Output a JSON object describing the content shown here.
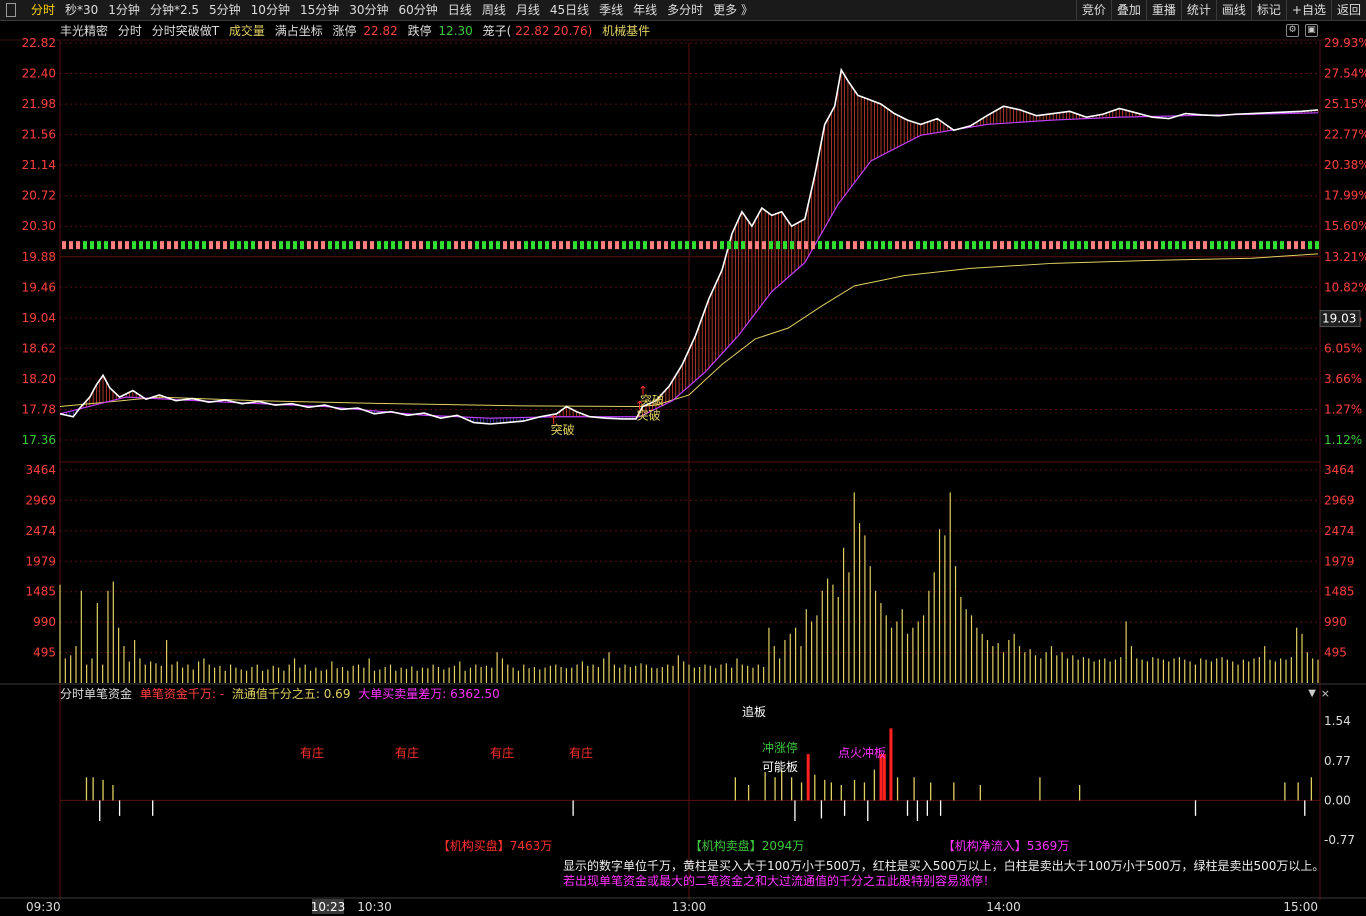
{
  "toolbar": {
    "periods": [
      "分时",
      "秒*30",
      "1分钟",
      "分钟*2.5",
      "5分钟",
      "10分钟",
      "15分钟",
      "30分钟",
      "60分钟",
      "日线",
      "周线",
      "月线",
      "45日线",
      "季线",
      "年线",
      "多分时",
      "更多 》"
    ],
    "active_period": "分时",
    "right_tools": [
      "竞价",
      "叠加",
      "重播",
      "统计",
      "画线",
      "标记",
      "+自选",
      "返回"
    ]
  },
  "info": {
    "stock_name": "丰光精密",
    "view": "分时",
    "indicator": "分时突破做T",
    "volume_label": "成交量",
    "coord_label": "满占坐标",
    "limit_up_label": "涨停",
    "limit_up": "22.82",
    "limit_down_label": "跌停",
    "limit_down": "12.30",
    "cage_label": "笼子(",
    "cage_values": "22.82 20.76)",
    "sector": "机械基件"
  },
  "colors": {
    "up": "#ff4040",
    "down": "#3cc83c",
    "price_line": "#ffffff",
    "avg_line": "#c040ff",
    "yellow_line": "#e0d060",
    "grid": "#5a1010",
    "volume": "#e0d060",
    "axis_text_up": "#ff4040",
    "axis_text_down": "#3cc83c"
  },
  "current_price_tag": "19.03",
  "time_cursor": "10:23",
  "chart_data": [
    {
      "type": "line",
      "title": "分时",
      "y_left_ticks": [
        "22.82",
        "22.40",
        "21.98",
        "21.56",
        "21.14",
        "20.72",
        "20.30",
        "19.88",
        "19.46",
        "19.04",
        "18.62",
        "18.20",
        "17.78",
        "17.36"
      ],
      "y_right_ticks": [
        "29.93%",
        "27.54%",
        "25.15%",
        "22.77%",
        "20.38%",
        "17.99%",
        "15.60%",
        "13.21%",
        "10.82%",
        "8.44%",
        "6.05%",
        "3.66%",
        "1.27%",
        "1.12%"
      ],
      "ylim": [
        17.36,
        22.82
      ],
      "x_ticks": [
        "09:30",
        "10:30",
        "13:00",
        "14:00",
        "15:00"
      ],
      "series": [
        {
          "name": "分时",
          "points": [
            [
              0,
              17.72
            ],
            [
              4,
              17.68
            ],
            [
              6,
              17.8
            ],
            [
              9,
              17.95
            ],
            [
              11,
              18.12
            ],
            [
              13,
              18.25
            ],
            [
              15,
              18.08
            ],
            [
              18,
              17.95
            ],
            [
              22,
              18.04
            ],
            [
              26,
              17.92
            ],
            [
              30,
              17.98
            ],
            [
              35,
              17.9
            ],
            [
              40,
              17.93
            ],
            [
              45,
              17.88
            ],
            [
              50,
              17.91
            ],
            [
              55,
              17.86
            ],
            [
              60,
              17.89
            ],
            [
              65,
              17.84
            ],
            [
              70,
              17.86
            ],
            [
              75,
              17.81
            ],
            [
              80,
              17.84
            ],
            [
              85,
              17.78
            ],
            [
              90,
              17.8
            ],
            [
              95,
              17.72
            ],
            [
              100,
              17.75
            ],
            [
              105,
              17.7
            ],
            [
              110,
              17.73
            ],
            [
              115,
              17.66
            ],
            [
              120,
              17.7
            ],
            [
              125,
              17.6
            ],
            [
              130,
              17.58
            ],
            [
              135,
              17.6
            ],
            [
              140,
              17.62
            ],
            [
              145,
              17.68
            ],
            [
              150,
              17.72
            ],
            [
              153,
              17.82
            ],
            [
              156,
              17.75
            ],
            [
              160,
              17.68
            ],
            [
              165,
              17.66
            ],
            [
              170,
              17.65
            ],
            [
              174,
              17.65
            ],
            [
              176,
              17.82
            ],
            [
              180,
              17.9
            ],
            [
              184,
              18.1
            ],
            [
              188,
              18.4
            ],
            [
              192,
              18.8
            ],
            [
              196,
              19.3
            ],
            [
              200,
              19.7
            ],
            [
              203,
              20.2
            ],
            [
              206,
              20.5
            ],
            [
              209,
              20.3
            ],
            [
              212,
              20.55
            ],
            [
              215,
              20.45
            ],
            [
              218,
              20.5
            ],
            [
              221,
              20.3
            ],
            [
              225,
              20.4
            ],
            [
              228,
              21.0
            ],
            [
              231,
              21.7
            ],
            [
              234,
              21.95
            ],
            [
              236,
              22.45
            ],
            [
              238,
              22.3
            ],
            [
              241,
              22.1
            ],
            [
              244,
              22.05
            ],
            [
              248,
              21.98
            ],
            [
              252,
              21.85
            ],
            [
              256,
              21.76
            ],
            [
              260,
              21.7
            ],
            [
              265,
              21.78
            ],
            [
              270,
              21.62
            ],
            [
              275,
              21.68
            ],
            [
              280,
              21.82
            ],
            [
              285,
              21.95
            ],
            [
              290,
              21.9
            ],
            [
              295,
              21.82
            ],
            [
              300,
              21.85
            ],
            [
              305,
              21.88
            ],
            [
              310,
              21.8
            ],
            [
              315,
              21.84
            ],
            [
              320,
              21.92
            ],
            [
              325,
              21.86
            ],
            [
              330,
              21.8
            ],
            [
              335,
              21.78
            ],
            [
              340,
              21.85
            ],
            [
              345,
              21.83
            ],
            [
              350,
              21.82
            ],
            [
              355,
              21.84
            ],
            [
              360,
              21.85
            ],
            [
              365,
              21.86
            ],
            [
              370,
              21.87
            ],
            [
              375,
              21.88
            ],
            [
              380,
              21.9
            ]
          ]
        },
        {
          "name": "均价",
          "points": [
            [
              0,
              17.72
            ],
            [
              20,
              17.95
            ],
            [
              50,
              17.88
            ],
            [
              80,
              17.82
            ],
            [
              110,
              17.7
            ],
            [
              130,
              17.66
            ],
            [
              150,
              17.68
            ],
            [
              175,
              17.68
            ],
            [
              185,
              17.9
            ],
            [
              195,
              18.3
            ],
            [
              205,
              18.8
            ],
            [
              215,
              19.4
            ],
            [
              225,
              19.8
            ],
            [
              235,
              20.6
            ],
            [
              245,
              21.2
            ],
            [
              260,
              21.55
            ],
            [
              280,
              21.7
            ],
            [
              300,
              21.76
            ],
            [
              320,
              21.8
            ],
            [
              340,
              21.82
            ],
            [
              360,
              21.84
            ],
            [
              380,
              21.86
            ]
          ]
        },
        {
          "name": "黄线",
          "points": [
            [
              0,
              17.82
            ],
            [
              30,
              17.95
            ],
            [
              60,
              17.9
            ],
            [
              100,
              17.86
            ],
            [
              140,
              17.83
            ],
            [
              175,
              17.82
            ],
            [
              180,
              17.84
            ],
            [
              190,
              17.98
            ],
            [
              200,
              18.4
            ],
            [
              210,
              18.75
            ],
            [
              220,
              18.9
            ],
            [
              230,
              19.2
            ],
            [
              240,
              19.48
            ],
            [
              255,
              19.62
            ],
            [
              275,
              19.72
            ],
            [
              300,
              19.79
            ],
            [
              330,
              19.83
            ],
            [
              360,
              19.86
            ],
            [
              380,
              19.92
            ]
          ]
        }
      ],
      "annotations": [
        {
          "text": "突破",
          "x": 150,
          "y": 17.5
        },
        {
          "text": "突破",
          "x": 177,
          "y": 17.9
        },
        {
          "text": "突破",
          "x": 176,
          "y": 17.7
        }
      ]
    },
    {
      "type": "bar",
      "title": "成交量",
      "y_ticks": [
        "3464",
        "2969",
        "2474",
        "1979",
        "1485",
        "990",
        "495"
      ],
      "ylim": [
        0,
        3464
      ],
      "values": [
        1600,
        400,
        450,
        600,
        1500,
        300,
        400,
        1300,
        300,
        1500,
        1650,
        900,
        600,
        350,
        700,
        400,
        300,
        350,
        320,
        280,
        700,
        300,
        350,
        250,
        300,
        220,
        350,
        400,
        300,
        250,
        280,
        200,
        300,
        250,
        220,
        200,
        260,
        300,
        200,
        220,
        280,
        250,
        200,
        300,
        400,
        250,
        300,
        200,
        250,
        200,
        220,
        350,
        240,
        260,
        200,
        280,
        300,
        250,
        400,
        200,
        220,
        260,
        300,
        200,
        250,
        230,
        270,
        200,
        250,
        240,
        300,
        260,
        220,
        250,
        280,
        350,
        200,
        250,
        300,
        260,
        280,
        250,
        500,
        400,
        300,
        250,
        200,
        300,
        240,
        260,
        220,
        250,
        280,
        300,
        260,
        240,
        250,
        300,
        350,
        280,
        300,
        260,
        400,
        500,
        300,
        250,
        300,
        260,
        280,
        320,
        300,
        250,
        240,
        260,
        300,
        280,
        450,
        350,
        300,
        250,
        260,
        300,
        280,
        240,
        300,
        320,
        250,
        400,
        300,
        280,
        250,
        300,
        260,
        900,
        600,
        400,
        700,
        800,
        900,
        600,
        1200,
        1000,
        1100,
        1500,
        1700,
        1600,
        1400,
        2200,
        1800,
        3100,
        2600,
        2400,
        1900,
        1500,
        1300,
        1100,
        900,
        1000,
        1200,
        800,
        900,
        1000,
        1100,
        1500,
        1800,
        2500,
        2400,
        3100,
        1900,
        1400,
        1200,
        1100,
        900,
        800,
        700,
        600,
        650,
        500,
        700,
        800,
        600,
        500,
        550,
        450,
        400,
        500,
        600,
        450,
        500,
        400,
        450,
        380,
        420,
        400,
        350,
        380,
        400,
        350,
        380,
        420,
        1000,
        600,
        400,
        380,
        350,
        420,
        400,
        380,
        350,
        400,
        420,
        380,
        350,
        300,
        400,
        380,
        350,
        400,
        420,
        380,
        350,
        300,
        380,
        350,
        400,
        420,
        600,
        380,
        350,
        400,
        380,
        420,
        900,
        800,
        500,
        400,
        380
      ]
    },
    {
      "type": "bar",
      "title": "分时单笔资金",
      "y_ticks": [
        "1.54",
        "0.77",
        "0.00",
        "-0.77"
      ],
      "ylim": [
        -1.1,
        1.7
      ],
      "labels": [
        {
          "text": "追板",
          "color": "#ffffff"
        },
        {
          "text": "有庄",
          "color": "#ff3030"
        },
        {
          "text": "冲涨停",
          "color": "#3cc83c"
        },
        {
          "text": "可能板",
          "color": "#ffffff"
        },
        {
          "text": "点火冲板",
          "color": "#ff33ff"
        },
        {
          "text": "【机构买盘】7463万",
          "color": "#ff3030"
        },
        {
          "text": "【机构卖盘】2094万",
          "color": "#3cc83c"
        },
        {
          "text": "【机构净流入】5369万",
          "color": "#ff33ff"
        }
      ]
    }
  ],
  "fund_panel": {
    "title": "分时单笔资金",
    "single_label": "单笔资金千万: -",
    "float_label": "流通值千分之五: 0.69",
    "diff_label": "大单买卖量差万: 6362.50"
  },
  "legend_note": {
    "line1": "显示的数字单位千万，黄柱是买入大于100万小于500万，红柱是买入500万以上，白柱是卖出大于100万小于500万，绿柱是卖出500万以上。",
    "line2": "若出现单笔资金或最大的二笔资金之和大过流通值的千分之五此股特别容易涨停！"
  }
}
